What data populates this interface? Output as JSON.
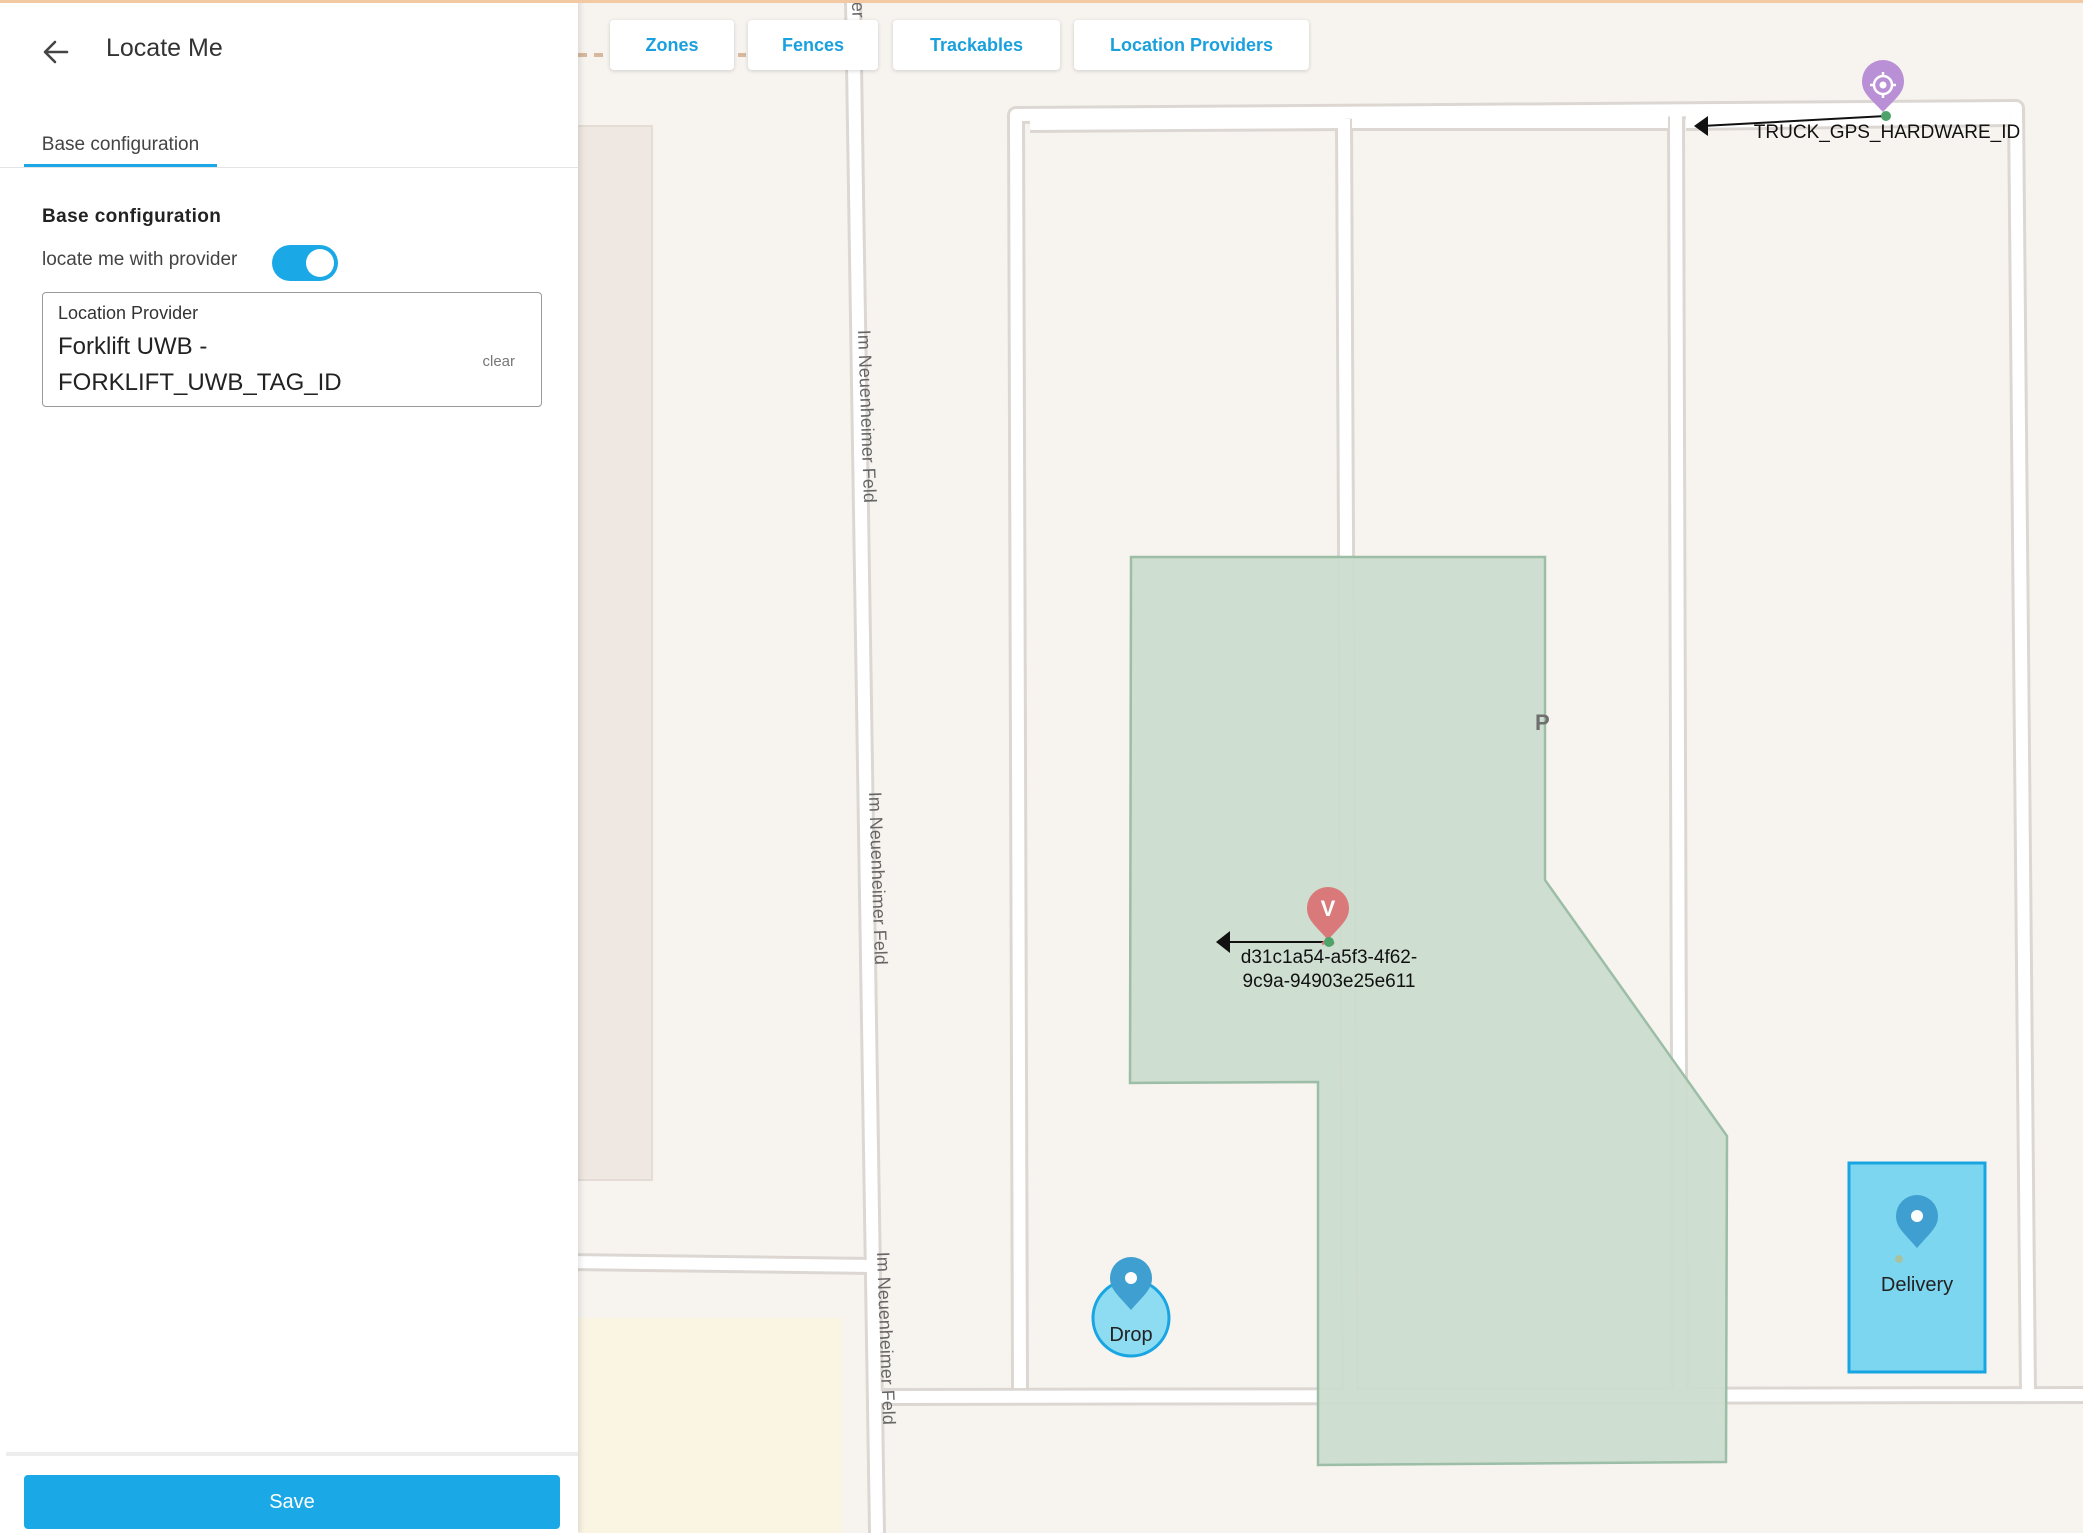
{
  "panel": {
    "title": "Locate Me",
    "tab": "Base configuration",
    "section_title": "Base configuration",
    "toggle_label": "locate me with provider",
    "toggle_on": true,
    "field": {
      "label": "Location Provider",
      "value": "Forklift UWB - FORKLIFT_UWB_TAG_ID",
      "clear_label": "clear"
    },
    "save_label": "Save"
  },
  "toolbar": {
    "zones": "Zones",
    "fences": "Fences",
    "trackables": "Trackables",
    "location_providers": "Location Providers"
  },
  "map": {
    "street_name": "Im Neuenheimer Feld",
    "street_fragment": "er",
    "parking_label": "P",
    "trackables": {
      "truck": "TRUCK_GPS_HARDWARE_ID",
      "forklift_line1": "d31c1a54-a5f3-4f62-",
      "forklift_line2": "9c9a-94903e25e611"
    },
    "zones": {
      "drop": "Drop",
      "delivery": "Delivery"
    }
  },
  "colors": {
    "accent": "#1aa9e6",
    "fence": "#cbdccd",
    "delivery_zone": "#7dd6f0",
    "truck_pin": "#b98fd6",
    "forklift_pin": "#d97979"
  }
}
